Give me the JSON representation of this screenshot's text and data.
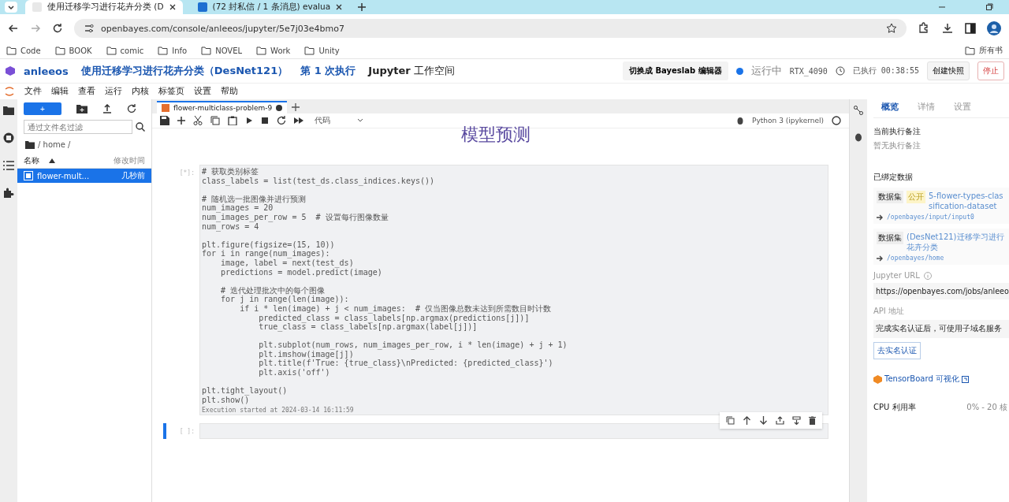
{
  "browser": {
    "tabs": [
      {
        "title": "使用迁移学习进行花卉分类 (D",
        "selected": true
      },
      {
        "title": "(72 封私信 / 1 条消息) evalua",
        "selected": false
      }
    ],
    "url": "openbayes.com/console/anleeos/jupyter/5e7j03e4bmo7",
    "bookmarks": [
      "Code",
      "BOOK",
      "comic",
      "Info",
      "NOVEL",
      "Work",
      "Unity"
    ],
    "bookmarks_right": "所有书"
  },
  "header": {
    "user": "anleeos",
    "project": "使用迁移学习进行花卉分类（DesNet121）",
    "run": "第 1 次执行",
    "workspace_bold": "Jupyter",
    "workspace": "工作空间",
    "switch_button": "切换成 Bayeslab 编辑器",
    "status": "运行中",
    "gpu": "RTX_4090",
    "elapsed": "已执行 00:38:55",
    "snapshot_button": "创建快照",
    "stop_button": "停止"
  },
  "menu": [
    "文件",
    "编辑",
    "查看",
    "运行",
    "内核",
    "标签页",
    "设置",
    "帮助"
  ],
  "file_browser": {
    "new_button": "+",
    "filter_placeholder": "通过文件名过滤",
    "path": "/ home /",
    "columns": [
      "名称",
      "修改时间"
    ],
    "files": [
      {
        "name": "flower-mult...",
        "modified": "几秒前",
        "selected": true
      }
    ]
  },
  "notebook": {
    "tab": {
      "title": "flower-multiclass-problem-9",
      "selected": true
    },
    "cell_type": "代码",
    "kernel": "Python 3 (ipykernel)",
    "heading": "模型预测",
    "cells": [
      {
        "prompt": "[*]:",
        "active": false,
        "code": "# 获取类别标签\nclass_labels = list(test_ds.class_indices.keys())\n\n# 随机选一批图像并进行预测\nnum_images = 20\nnum_images_per_row = 5  # 设置每行图像数量\nnum_rows = 4\n\nplt.figure(figsize=(15, 10))\nfor i in range(num_images):\n    image, label = next(test_ds)\n    predictions = model.predict(image)\n\n    # 迭代处理批次中的每个图像\n    for j in range(len(image)):\n        if i * len(image) + j < num_images:  # 仅当图像总数未达到所需数目时计数\n            predicted_class = class_labels[np.argmax(predictions[j])]\n            true_class = class_labels[np.argmax(label[j])]\n\n            plt.subplot(num_rows, num_images_per_row, i * len(image) + j + 1)\n            plt.imshow(image[j])\n            plt.title(f'True: {true_class}\\nPredicted: {predicted_class}')\n            plt.axis('off')\n\nplt.tight_layout()\nplt.show()",
        "status": "Execution started at 2024-03-14 16:11:59"
      },
      {
        "prompt": "[ ]:",
        "active": true
      }
    ]
  },
  "panel": {
    "tabs": [
      {
        "label": "概览",
        "selected": true
      },
      {
        "label": "详情",
        "selected": false
      },
      {
        "label": "设置",
        "selected": false
      }
    ],
    "note_title": "当前执行备注",
    "note": "暂无执行备注",
    "bound_title": "已绑定数据",
    "datasets": [
      {
        "tag": "数据集",
        "badge": "公开",
        "name": "5-flower-types-classification-dataset",
        "path": "/openbayes/input/input0"
      },
      {
        "tag": "数据集",
        "name": "(DesNet121)迁移学习进行花卉分类",
        "path": "/openbayes/home"
      }
    ],
    "jupyter_label": "Jupyter URL",
    "jupyter_url": "https://openbayes.com/jobs/anleeo",
    "api_label": "API 地址",
    "api_value": "完成实名认证后，可使用子域名服务",
    "verify_button": "去实名认证",
    "tensorboard": "TensorBoard 可视化",
    "cpu_label": "CPU 利用率",
    "cpu_value": "0% - 20 核"
  }
}
